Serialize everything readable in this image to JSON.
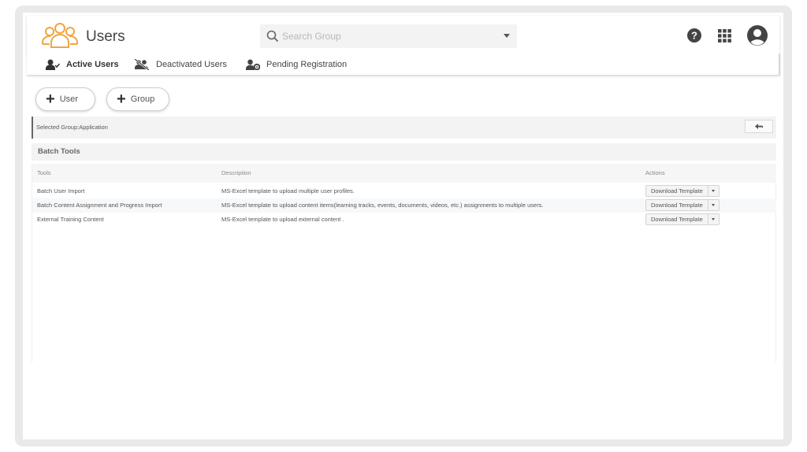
{
  "header": {
    "title": "Users",
    "logo_icon": "users-group-icon",
    "brand_color": "#f0a640",
    "search": {
      "placeholder": "Search Group",
      "value": "",
      "icon": "search-icon"
    },
    "right_icons": [
      "help-icon",
      "apps-grid-icon",
      "account-icon"
    ]
  },
  "tabs": [
    {
      "label": "Active Users",
      "icon": "user-check-icon",
      "active": true
    },
    {
      "label": "Deactivated Users",
      "icon": "users-slash-icon",
      "active": false
    },
    {
      "label": "Pending Registration",
      "icon": "user-gear-icon",
      "active": false
    }
  ],
  "actions": {
    "add_user": "User",
    "add_group": "Group"
  },
  "selected_group": {
    "label": "Selected Group:Application",
    "back_icon": "reply-arrow-icon"
  },
  "batch_tools": {
    "title": "Batch Tools",
    "columns": [
      "Tools",
      "Description",
      "Actions"
    ],
    "rows": [
      {
        "tool": "Batch User Import",
        "description": "MS-Excel template to upload multiple user profiles.",
        "action": "Download Template"
      },
      {
        "tool": "Batch Content Assignment and Progress Import",
        "description": "MS-Excel template to upload content items(learning tracks, events, documents, videos, etc.) assignments to multiple users.",
        "action": "Download Template"
      },
      {
        "tool": "External Training Content",
        "description": "MS-Excel template to upload external content .",
        "action": "Download Template"
      }
    ]
  }
}
